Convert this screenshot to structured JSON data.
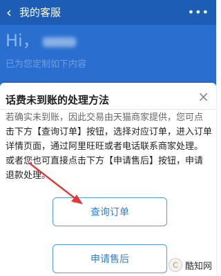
{
  "header": {
    "title": "我的客服",
    "back_icon": "‹",
    "more_icon": "•••",
    "greeting": "Hi，",
    "subtitle": "已为您定制如下内容"
  },
  "sheet": {
    "title": "话费未到账的处理方法",
    "close_icon": "×",
    "line1": "若确实未到账，因此交易由天猫商家提供，您可点",
    "line2": "击下方【查询订单】按钮，选择对应订单，进入订单",
    "line3": "详情页面，通过阿里旺旺或者电话联系商家处理。",
    "line4": "或者您也可直接点击下方【申请售后】按钮，申请",
    "line5": "退款处理。",
    "btn_query": "查询订单",
    "btn_refund": "申请售后"
  },
  "watermark": {
    "icon": "C",
    "text": "酷知网"
  },
  "colors": {
    "header": "#2a6fd0",
    "button_border": "#4f9be6",
    "arrow": "#e03a3a"
  }
}
